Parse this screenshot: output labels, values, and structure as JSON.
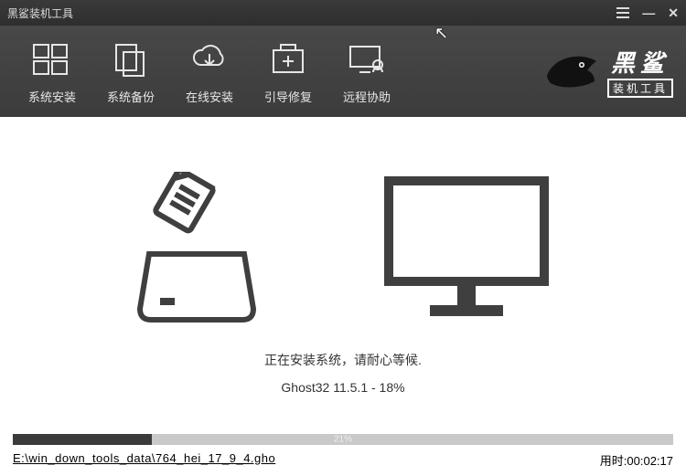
{
  "window": {
    "title": "黑鲨装机工具"
  },
  "toolbar": {
    "items": [
      {
        "label": "系统安装"
      },
      {
        "label": "系统备份"
      },
      {
        "label": "在线安装"
      },
      {
        "label": "引导修复"
      },
      {
        "label": "远程协助"
      }
    ]
  },
  "brand": {
    "name": "黑鲨",
    "sub": "装机工具"
  },
  "status": {
    "message": "正在安装系统，请耐心等候.",
    "ghost": "Ghost32 11.5.1 - 18%"
  },
  "progress": {
    "percent_label": "21%",
    "percent_value": 21
  },
  "footer": {
    "filepath": "E:\\win_down_tools_data\\764_hei_17_9_4.gho",
    "elapsed_label": "用时:",
    "elapsed_value": "00:02:17"
  }
}
